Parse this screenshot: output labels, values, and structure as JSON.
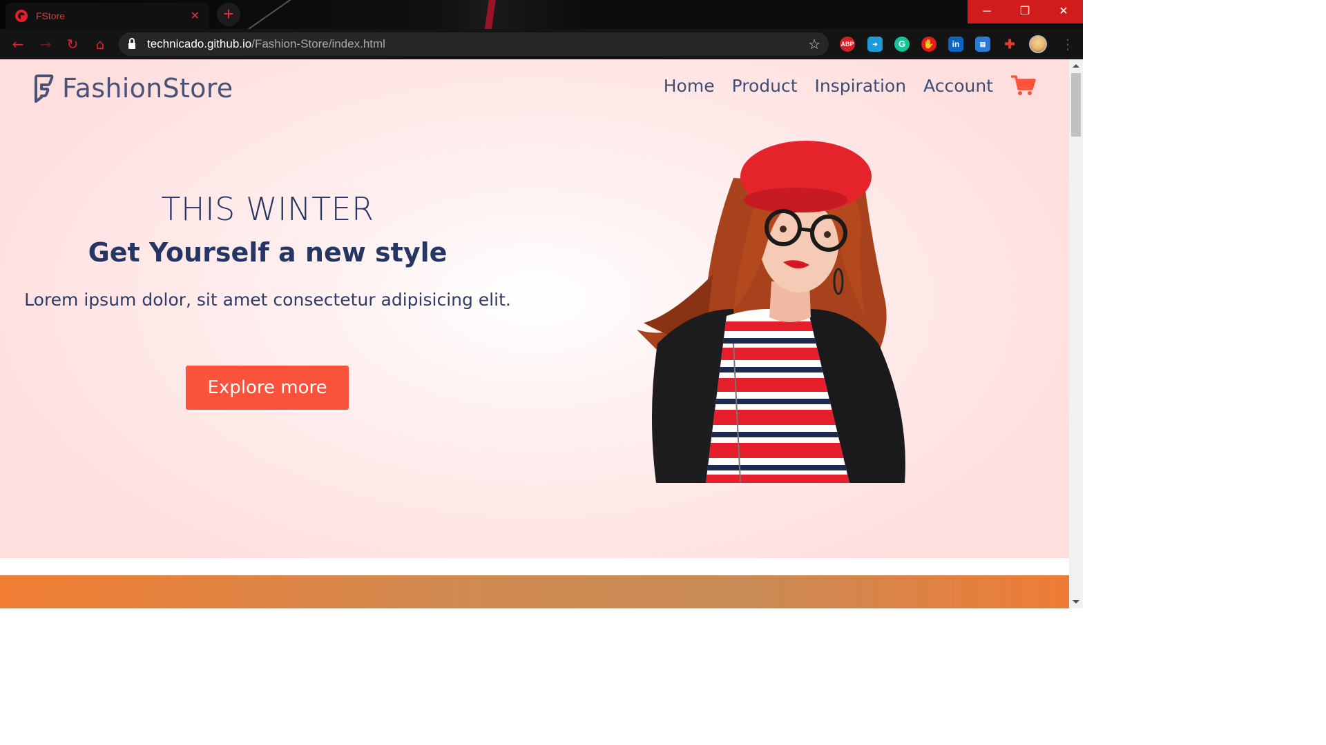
{
  "browser": {
    "tab_title": "FStore",
    "tab_close": "✕",
    "new_tab": "+",
    "url_host": "technicado.github.io",
    "url_path": "/Fashion-Store/index.html",
    "window_controls": {
      "minimize": "─",
      "restore": "❐",
      "close": "✕"
    },
    "extensions": [
      {
        "name": "adblock-plus-icon",
        "label": "ABP",
        "color": "#d51f26"
      },
      {
        "name": "share-icon",
        "label": "",
        "color": "#1c9bd8"
      },
      {
        "name": "grammarly-icon",
        "label": "G",
        "color": "#15c39a"
      },
      {
        "name": "stop-hand-icon",
        "label": "",
        "color": "#e31d1d"
      },
      {
        "name": "linkedin-icon",
        "label": "in",
        "color": "#0a66c2"
      },
      {
        "name": "tabs-icon",
        "label": "",
        "color": "#2a7bd4"
      },
      {
        "name": "puzzle-icon",
        "label": "",
        "color": "#e23a2a"
      }
    ]
  },
  "site": {
    "logo_text": "FashionStore",
    "nav": [
      "Home",
      "Product",
      "Inspiration",
      "Account"
    ],
    "hero": {
      "title": "THIS WINTER",
      "subtitle": "Get Yourself a new style",
      "text": "Lorem ipsum dolor, sit amet consectetur adipisicing elit.",
      "cta": "Explore more"
    }
  },
  "colors": {
    "accent": "#fb523b",
    "heading": "#253564",
    "nav": "#3f4d73",
    "chrome_red": "#d9262c"
  }
}
